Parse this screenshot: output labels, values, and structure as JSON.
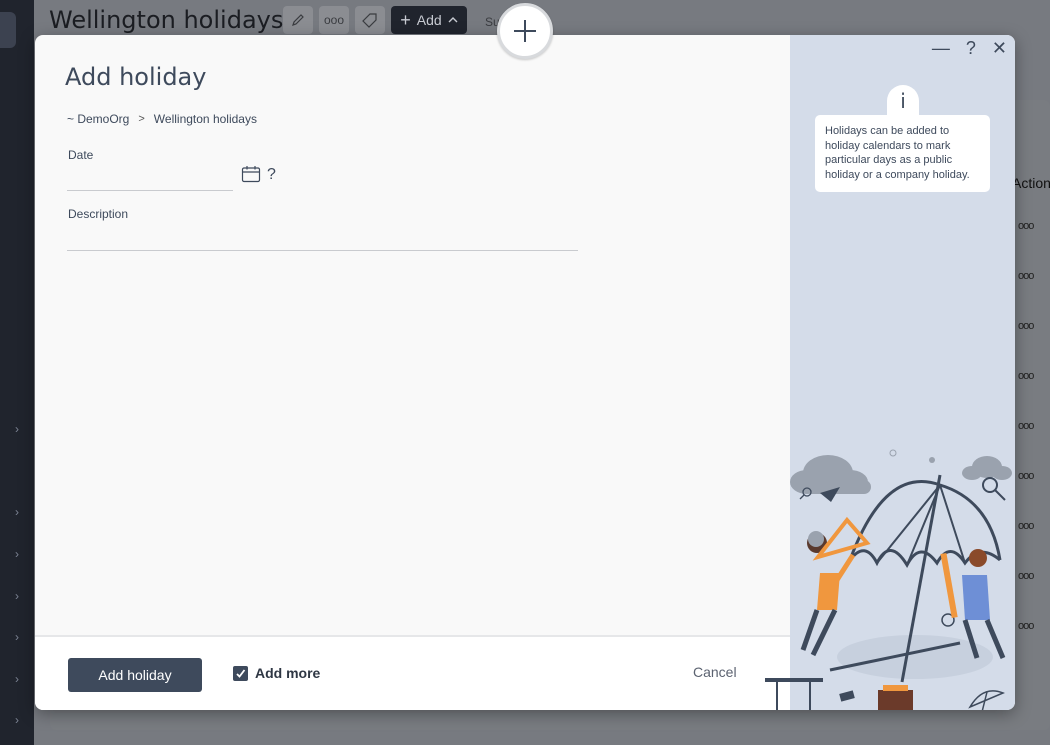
{
  "background": {
    "page_title": "Wellington holidays",
    "toolbar": {
      "edit_icon": "pencil-icon",
      "more_icon": "more-dots",
      "more_text": "ooo",
      "tag_icon": "tag-icon",
      "add_label": "Add",
      "sum_text": "Su"
    },
    "table": {
      "actions_header": "Action",
      "row_action": "ooo",
      "row_count": 9
    },
    "sidebar_chevron": "›"
  },
  "modal": {
    "title": "Add holiday",
    "breadcrumb": {
      "root": "~ DemoOrg",
      "separator": ">",
      "current": "Wellington holidays"
    },
    "fields": {
      "date": {
        "label": "Date",
        "value": "",
        "placeholder": "",
        "help": "?"
      },
      "description": {
        "label": "Description",
        "value": "",
        "placeholder": ""
      }
    },
    "footer": {
      "primary_label": "Add holiday",
      "add_more_label": "Add more",
      "add_more_checked": true,
      "cancel_label": "Cancel"
    },
    "window_controls": {
      "minimize": "—",
      "help": "?",
      "close": "✕"
    },
    "info": {
      "icon": "i",
      "text": "Holidays can be added to holiday calendars to mark particular days as a public holiday or a company holiday."
    }
  },
  "colors": {
    "primary": "#3e4a5c",
    "side_panel": "#d4dce9",
    "accent_orange": "#f0973e",
    "sidebar_dark": "#20242d"
  }
}
